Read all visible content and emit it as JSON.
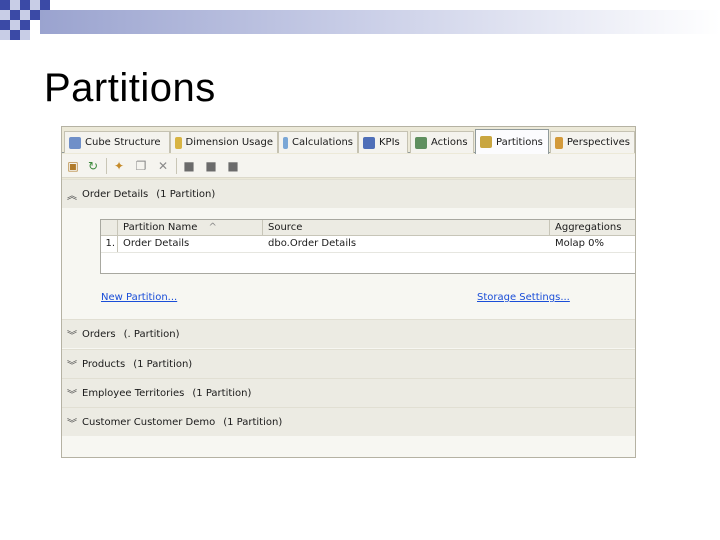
{
  "slide": {
    "title": "Partitions"
  },
  "tabs": [
    {
      "label": "Cube Structure",
      "icon": "cube-icon"
    },
    {
      "label": "Dimension Usage",
      "icon": "dimension-icon"
    },
    {
      "label": "Calculations",
      "icon": "calculator-icon"
    },
    {
      "label": "KPIs",
      "icon": "chart-icon"
    },
    {
      "label": "Actions",
      "icon": "gears-icon"
    },
    {
      "label": "Partitions",
      "icon": "partition-icon"
    },
    {
      "label": "Perspectives",
      "icon": "perspective-icon"
    }
  ],
  "active_tab": "Partitions",
  "toolbar": {
    "icons": [
      "new-partition-icon",
      "refresh-icon",
      "process-icon",
      "copy-icon",
      "delete-icon",
      "design-aggregations-icon",
      "usage-aggregations-icon",
      "merge-icon"
    ]
  },
  "groups": [
    {
      "name": "Order Details",
      "count": "(1 Partition)",
      "expanded": true
    },
    {
      "name": "Orders",
      "count": "(. Partition)",
      "expanded": false
    },
    {
      "name": "Products",
      "count": "(1 Partition)",
      "expanded": false
    },
    {
      "name": "Employee Territories",
      "count": "(1 Partition)",
      "expanded": false
    },
    {
      "name": "Customer Customer Demo",
      "count": "(1 Partition)",
      "expanded": false
    }
  ],
  "grid": {
    "columns": [
      "Partition Name",
      "Source",
      "Aggregations"
    ],
    "sort_indicator": "^",
    "rows": [
      {
        "num": "1.",
        "name": "Order Details",
        "source": "dbo.Order Details",
        "aggregations": "Molap 0%"
      }
    ]
  },
  "links": {
    "new_partition": "New Partition...",
    "storage_settings": "Storage Settings..."
  },
  "colors": {
    "link": "#1a4ed8",
    "checker_dark": "#3b4aa6",
    "checker_light": "#c8cde6",
    "panel": "#ece9d8"
  }
}
